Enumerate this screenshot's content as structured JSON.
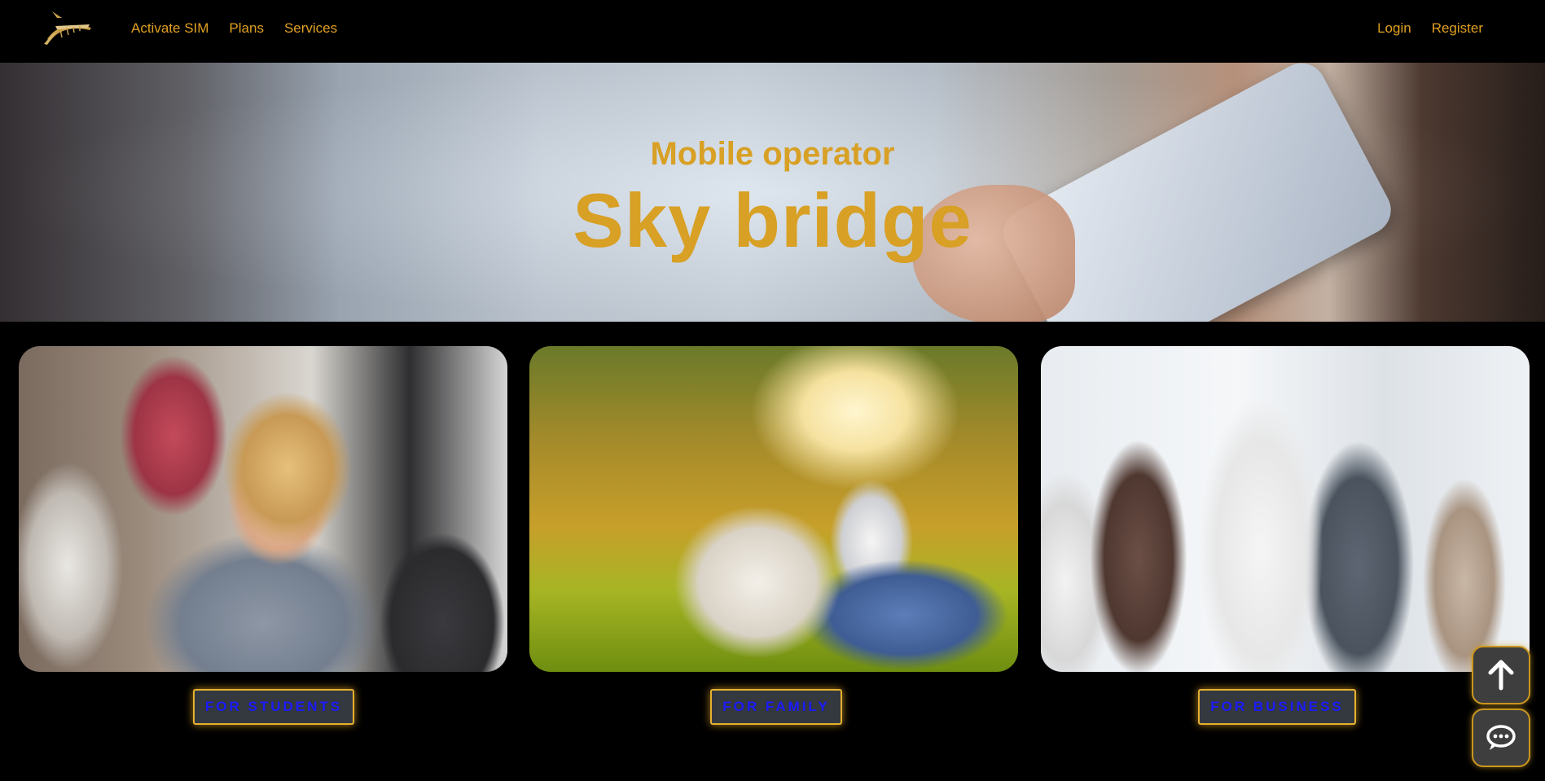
{
  "navbar": {
    "logo_alt": "Sky bridge",
    "left_links": [
      "Activate SIM",
      "Plans",
      "Services"
    ],
    "right_links": [
      "Login",
      "Register"
    ]
  },
  "hero": {
    "subtitle": "Mobile operator",
    "title": "Sky bridge"
  },
  "cards": [
    {
      "button_label": "FOR STUDENTS",
      "image": "students-photo"
    },
    {
      "button_label": "FOR FAMILY",
      "image": "family-photo"
    },
    {
      "button_label": "FOR BUSINESS",
      "image": "business-photo"
    }
  ],
  "floating": {
    "scroll_top_icon": "arrow-up-icon",
    "chat_icon": "chat-icon"
  },
  "colors": {
    "accent": "#d8a024",
    "button_text": "#1a1aff",
    "button_bg": "#34383f"
  }
}
